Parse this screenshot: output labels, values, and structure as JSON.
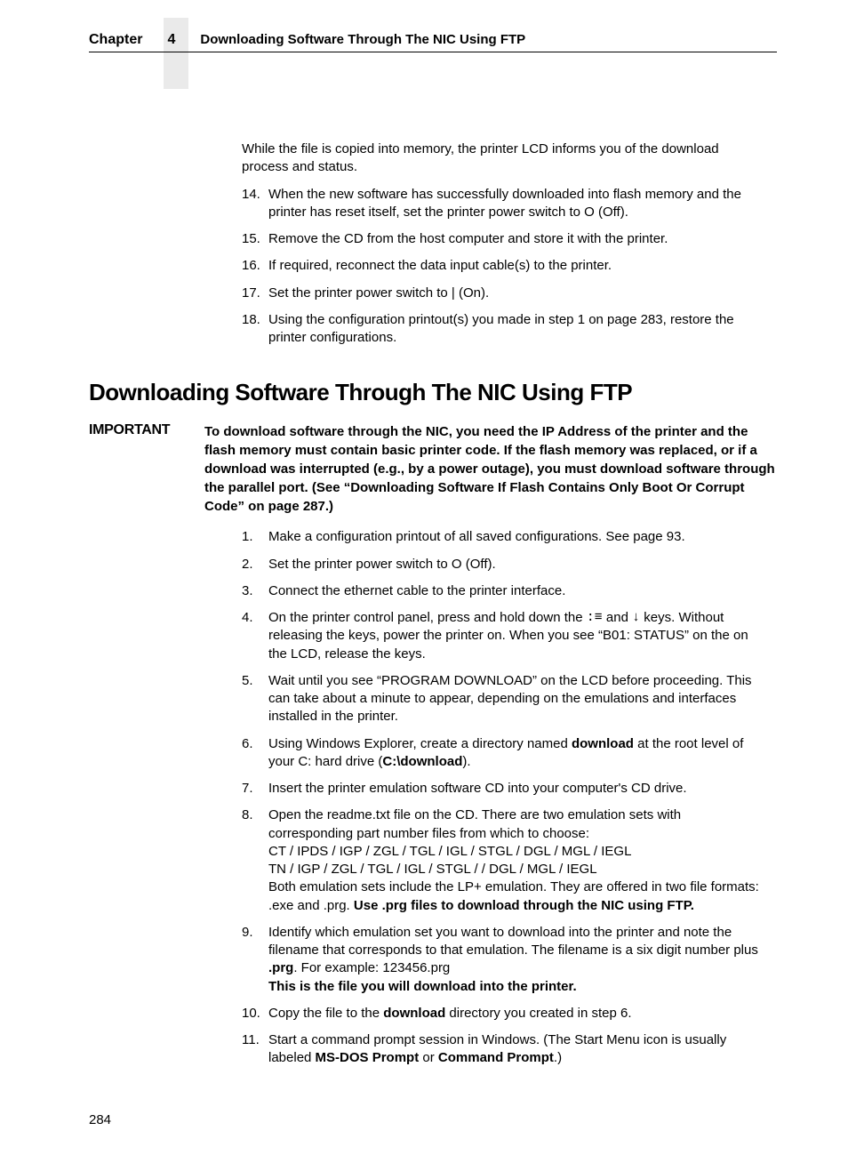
{
  "header": {
    "chapterLabel": "Chapter",
    "chapterNumber": "4",
    "chapterTitle": "Downloading Software Through The NIC Using FTP"
  },
  "introParagraph": "While the file is copied into memory, the printer LCD informs you of the download process and status.",
  "topList": [
    {
      "n": "14.",
      "text": "When the new software has successfully downloaded into flash memory and the printer has reset itself, set the printer power switch to O (Off)."
    },
    {
      "n": "15.",
      "text": "Remove the CD from the host computer and store it with the printer."
    },
    {
      "n": "16.",
      "text": "If required, reconnect the data input cable(s) to the printer."
    },
    {
      "n": "17.",
      "text": "Set the printer power switch to | (On)."
    },
    {
      "n": "18.",
      "text": "Using the configuration printout(s) you made in step 1 on page 283, restore the printer configurations."
    }
  ],
  "sectionHeading": "Downloading Software Through The NIC Using FTP",
  "important": {
    "label": "IMPORTANT",
    "body": "To download software through the NIC, you need the IP Address of the printer and the flash memory must contain basic printer code. If the flash memory was replaced, or if a download was interrupted (e.g., by a power outage), you must download software through the parallel port. (See “Downloading Software If Flash Contains Only Boot Or Corrupt Code” on page 287.)"
  },
  "mainList": {
    "i1": {
      "n": "1.",
      "text": "Make a configuration printout of all saved configurations. See page 93."
    },
    "i2": {
      "n": "2.",
      "text": "Set the printer power switch to O (Off)."
    },
    "i3": {
      "n": "3.",
      "text": "Connect the ethernet cable to the printer interface."
    },
    "i4": {
      "n": "4.",
      "pre": "On the printer control panel, press and hold down the ",
      "key1": ":≡",
      "mid": " and ",
      "key2": "↓",
      "post": " keys. Without releasing the keys, power the printer on. When you see “B01: STATUS” on the on the LCD, release the keys."
    },
    "i5": {
      "n": "5.",
      "text": "Wait until you see “PROGRAM DOWNLOAD” on the LCD before proceeding. This can take about a minute to appear, depending on the emulations and interfaces installed in the printer."
    },
    "i6": {
      "n": "6.",
      "pre": "Using Windows Explorer, create a directory named ",
      "b1": "download",
      "mid": " at the root level of your C: hard drive (",
      "b2": "C:\\download",
      "post": ")."
    },
    "i7": {
      "n": "7.",
      "text": "Insert the printer emulation software CD into your computer's CD drive."
    },
    "i8": {
      "n": "8.",
      "line1": "Open the readme.txt file on the CD. There are two emulation sets with corresponding part number files from which to choose:",
      "line2": "CT / IPDS / IGP / ZGL / TGL / IGL / STGL / DGL / MGL / IEGL",
      "line3": "TN / IGP / ZGL / TGL / IGL / STGL / / DGL / MGL / IEGL",
      "line4a": "Both emulation sets include the LP+ emulation. They are offered in two file formats: .exe and .prg. ",
      "line4b": "Use .prg files to download through the NIC using FTP."
    },
    "i9": {
      "n": "9.",
      "pre": "Identify which emulation set you want to download into the printer and note the filename that corresponds to that emulation. The filename is a six digit number plus ",
      "b1": ".prg",
      "post": ". For example: 123456.prg",
      "final": "This is the file you will download into the printer."
    },
    "i10": {
      "n": "10.",
      "pre": "Copy the file to the ",
      "b1": "download",
      "post": " directory you created in step 6."
    },
    "i11": {
      "n": "11.",
      "pre": "Start a command prompt session in Windows. (The Start Menu icon is usually labeled ",
      "b1": "MS-DOS Prompt",
      "mid": " or ",
      "b2": "Command Prompt",
      "post": ".)"
    }
  },
  "pageNumber": "284"
}
